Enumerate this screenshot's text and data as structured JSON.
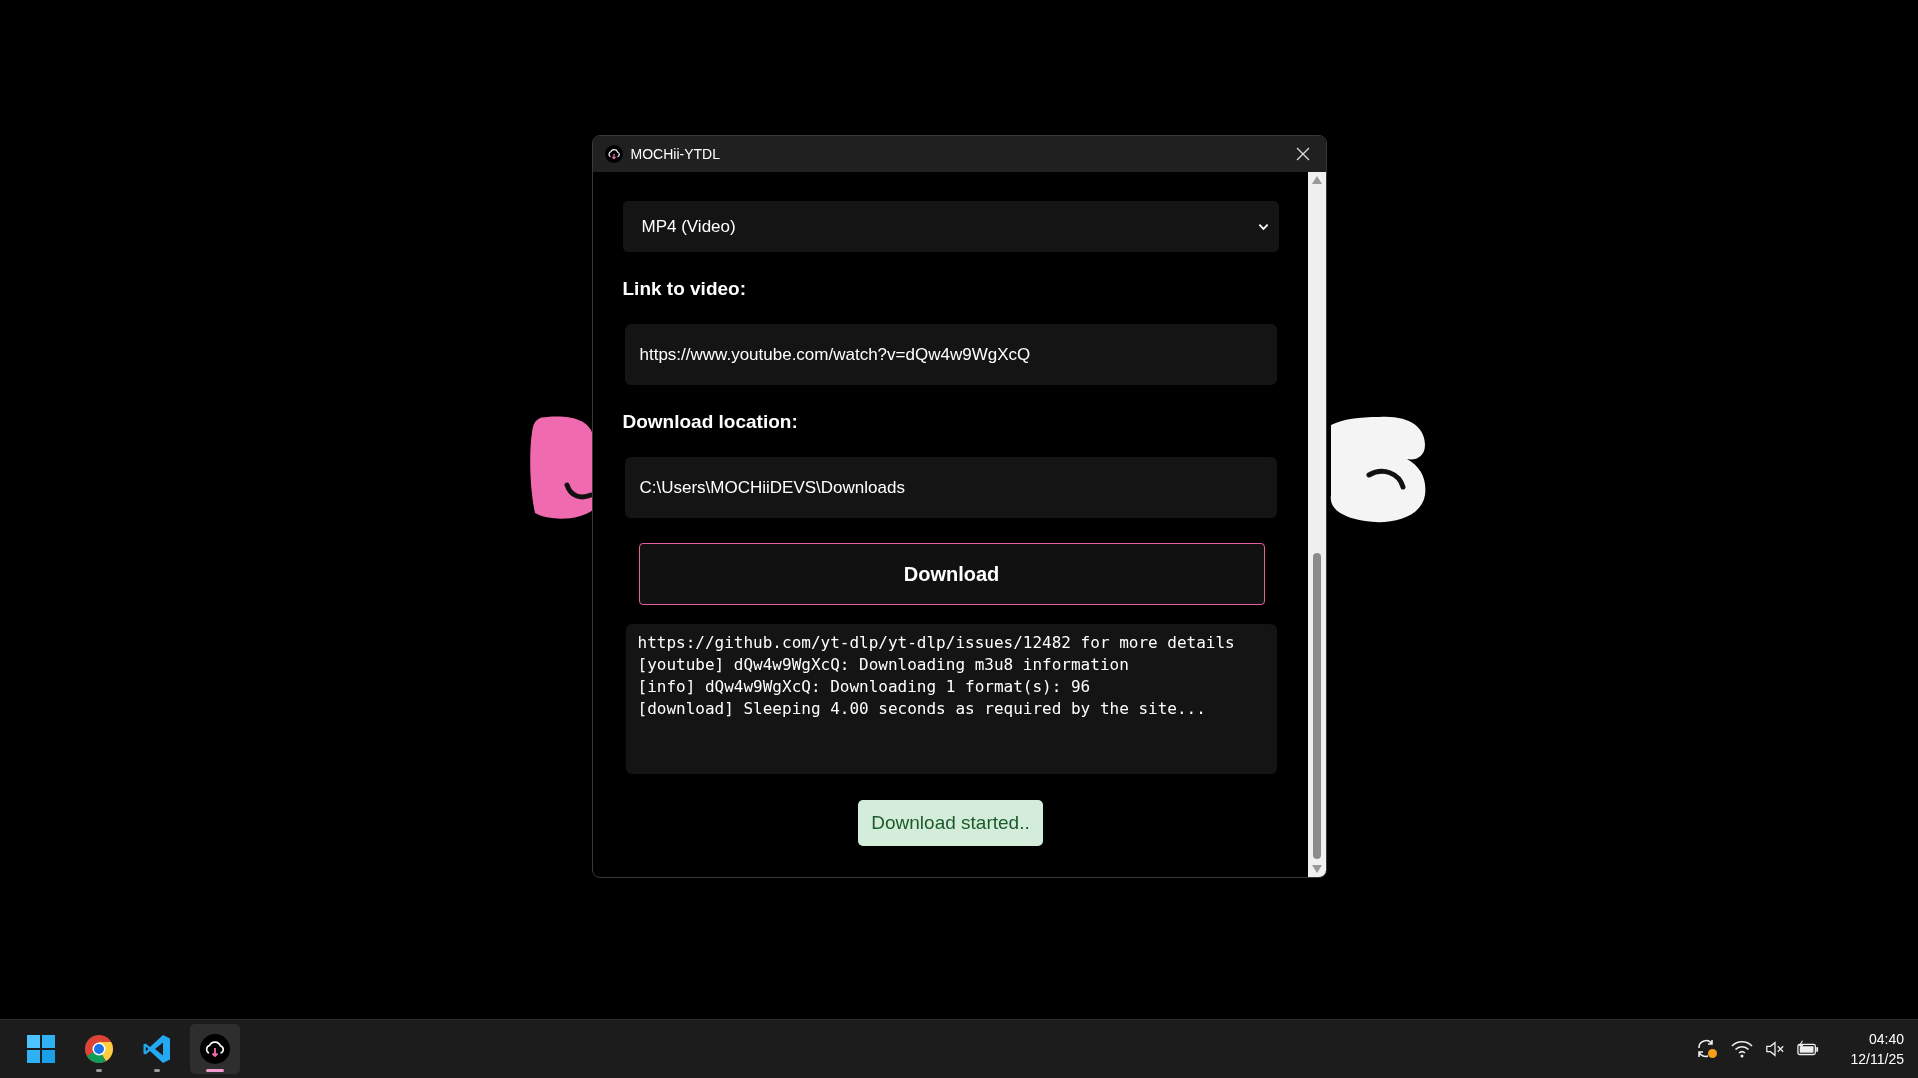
{
  "window": {
    "title": "MOCHii-YTDL"
  },
  "format_select": {
    "value": "MP4 (Video)"
  },
  "link": {
    "label": "Link to video:",
    "value": "https://www.youtube.com/watch?v=dQw4w9WgXcQ"
  },
  "location": {
    "label": "Download location:",
    "value": "C:\\Users\\MOCHiiDEVS\\Downloads"
  },
  "download_button": "Download",
  "log": [
    "https://github.com/yt-dlp/yt-dlp/issues/12482  for more details",
    "[youtube] dQw4w9WgXcQ: Downloading m3u8 information",
    "[info] dQw4w9WgXcQ: Downloading 1 format(s): 96",
    "[download] Sleeping 4.00 seconds as required by the site..."
  ],
  "toast": "Download started..",
  "taskbar": {
    "apps": [
      {
        "kind": "start",
        "selected": false
      },
      {
        "kind": "browser",
        "selected": false
      },
      {
        "kind": "editor",
        "selected": false
      },
      {
        "kind": "downloader",
        "selected": true
      }
    ],
    "clock": {
      "time": "04:40",
      "date": "12/11/25"
    }
  }
}
